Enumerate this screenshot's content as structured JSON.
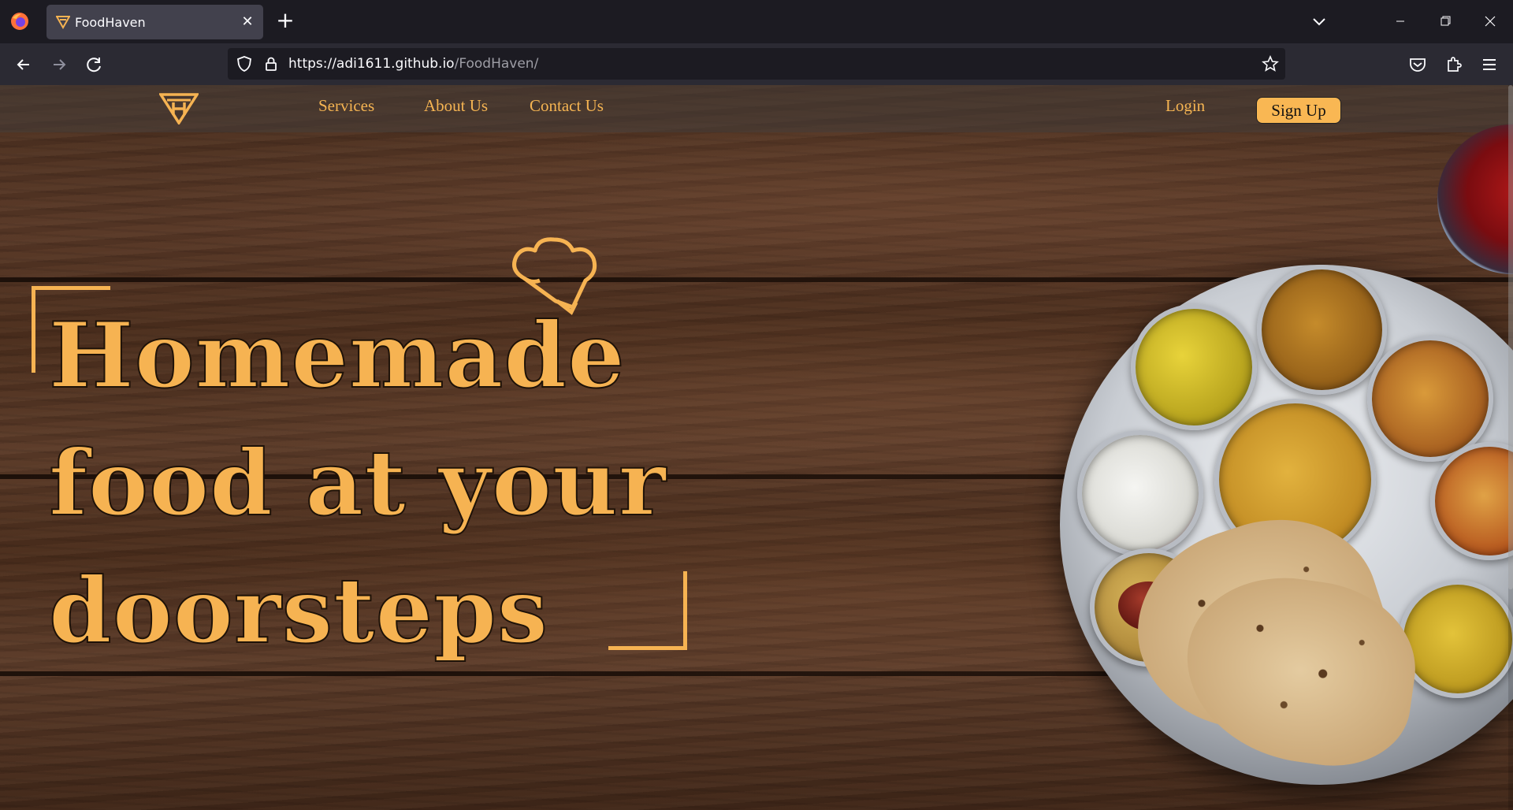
{
  "browser": {
    "tab_title": "FoodHaven",
    "url_host": "https://adi1611.github.io",
    "url_path": "/FoodHaven/"
  },
  "site": {
    "nav": {
      "services": "Services",
      "about": "About Us",
      "contact": "Contact Us",
      "login": "Login",
      "signup": "Sign Up"
    },
    "hero": {
      "line1": "Homemade",
      "line2": "food at your",
      "line3": "doorsteps"
    }
  },
  "colors": {
    "accent": "#f6b352",
    "chrome_bg": "#1c1b22",
    "toolbar_bg": "#2b2a33"
  },
  "icons": {
    "tab_favicon": "foodhaven-logo-icon",
    "back": "back-arrow-icon",
    "forward": "forward-arrow-icon",
    "reload": "reload-icon",
    "shield": "tracking-shield-icon",
    "lock": "lock-icon",
    "star": "bookmark-star-icon",
    "pocket": "pocket-icon",
    "extensions": "extensions-icon",
    "menu": "hamburger-menu-icon",
    "chef_hat": "chef-hat-icon"
  }
}
